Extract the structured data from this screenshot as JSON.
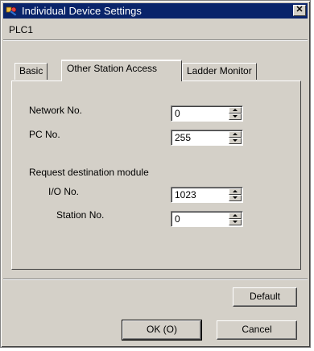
{
  "window": {
    "title": "Individual Device Settings",
    "close_glyph": "✕",
    "app_icon": "settings-app-icon"
  },
  "device": {
    "name": "PLC1"
  },
  "tabs": [
    {
      "label": "Basic",
      "active": false
    },
    {
      "label": "Other Station Access",
      "active": true
    },
    {
      "label": "Ladder Monitor",
      "active": false
    }
  ],
  "form": {
    "network_no": {
      "label": "Network No.",
      "value": "0"
    },
    "pc_no": {
      "label": "PC No.",
      "value": "255"
    },
    "request_section": {
      "label": "Request destination module"
    },
    "io_no": {
      "label": "I/O No.",
      "value": "1023"
    },
    "station_no": {
      "label": "Station No.",
      "value": "0"
    }
  },
  "buttons": {
    "default": "Default",
    "ok": "OK (O)",
    "cancel": "Cancel"
  },
  "colors": {
    "titlebar": "#0a246a",
    "face": "#d4d0c8"
  }
}
